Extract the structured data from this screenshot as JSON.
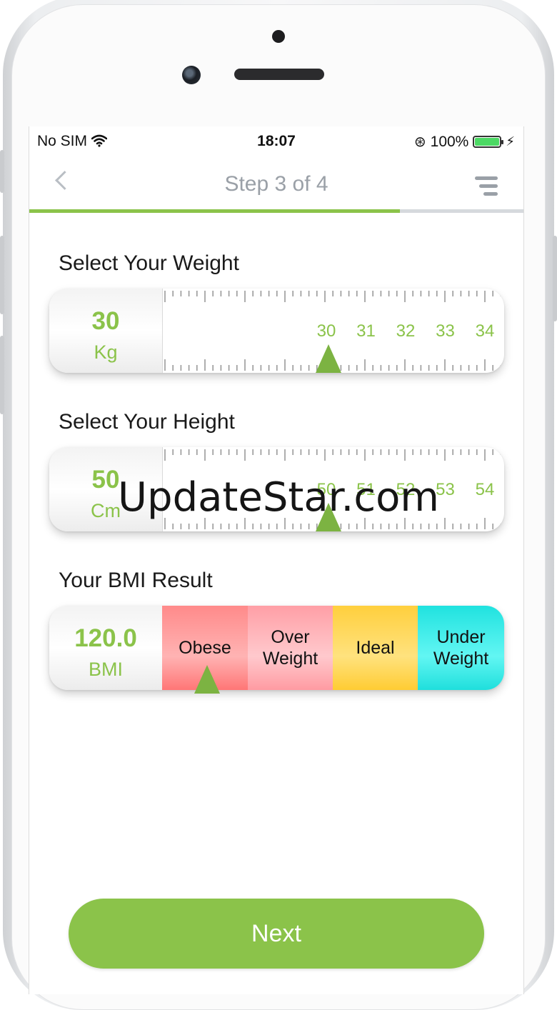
{
  "status_bar": {
    "carrier": "No SIM",
    "time": "18:07",
    "battery": "100%"
  },
  "navbar": {
    "title": "Step 3 of 4",
    "progress": 0.75
  },
  "weight": {
    "label": "Select Your Weight",
    "value": "30",
    "unit": "Kg",
    "ticks": [
      "30",
      "31",
      "32",
      "33",
      "34"
    ]
  },
  "height": {
    "label": "Select Your Height",
    "value": "50",
    "unit": "Cm",
    "ticks": [
      "50",
      "51",
      "52",
      "53",
      "54"
    ]
  },
  "bmi": {
    "label": "Your BMI Result",
    "value": "120.0",
    "unit": "BMI",
    "categories": [
      "Obese",
      "Over Weight",
      "Ideal",
      "Under Weight"
    ],
    "colors": {
      "obese": "#ff9a9a",
      "over": "#ffb8bd",
      "ideal": "#ffd84f",
      "under": "#3df0ec"
    }
  },
  "next_button": {
    "label": "Next"
  },
  "watermark": "UpdateStar.com",
  "accent_color": "#8bc34a"
}
